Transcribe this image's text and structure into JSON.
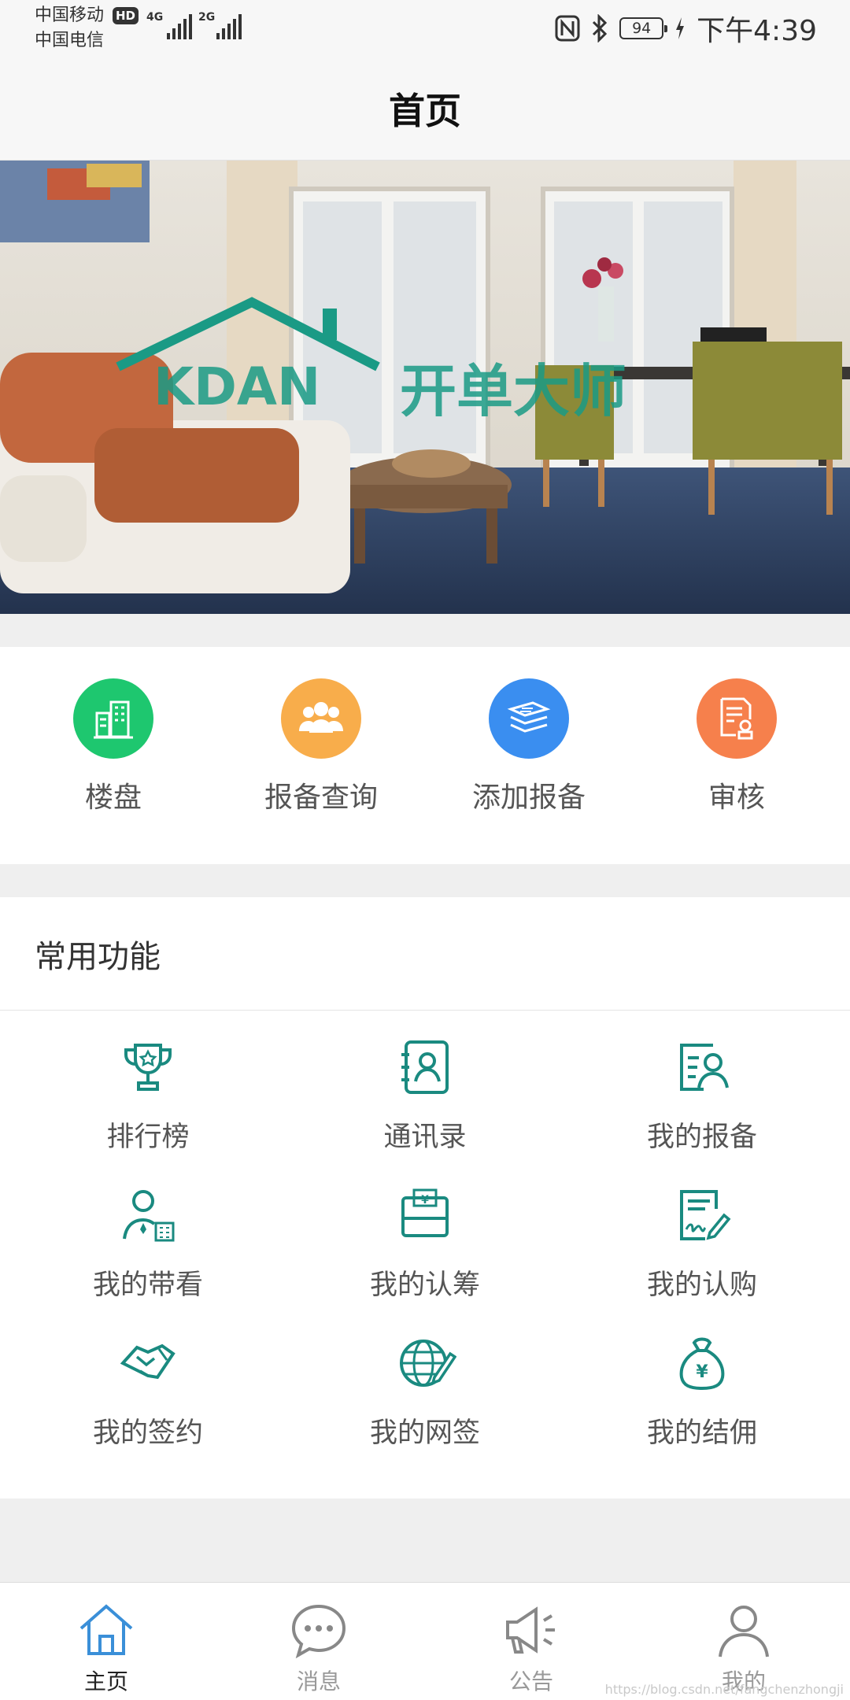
{
  "status_bar": {
    "carrier1": "中国移动",
    "hd": "HD",
    "net1": "4G",
    "carrier2": "中国电信",
    "net2": "2G",
    "battery": "94",
    "time": "下午4:39"
  },
  "header": {
    "title": "首页"
  },
  "banner": {
    "logo_text": "KDAN",
    "brand_text": "开单大师"
  },
  "quick_entries": [
    {
      "label": "楼盘",
      "icon": "buildings-icon",
      "color": "#1ec76f"
    },
    {
      "label": "报备查询",
      "icon": "people-group-icon",
      "color": "#f8ad4b"
    },
    {
      "label": "添加报备",
      "icon": "stack-icon",
      "color": "#3a8ef0"
    },
    {
      "label": "审核",
      "icon": "document-stamp-icon",
      "color": "#f6804c"
    }
  ],
  "common": {
    "title": "常用功能",
    "items": [
      {
        "label": "排行榜",
        "icon": "trophy-icon"
      },
      {
        "label": "通讯录",
        "icon": "contacts-icon"
      },
      {
        "label": "我的报备",
        "icon": "person-card-icon"
      },
      {
        "label": "我的带看",
        "icon": "person-building-icon"
      },
      {
        "label": "我的认筹",
        "icon": "wallet-yen-icon"
      },
      {
        "label": "我的认购",
        "icon": "document-sign-icon"
      },
      {
        "label": "我的签约",
        "icon": "handshake-icon"
      },
      {
        "label": "我的网签",
        "icon": "globe-pen-icon"
      },
      {
        "label": "我的结佣",
        "icon": "money-bag-icon"
      }
    ]
  },
  "tabs": [
    {
      "label": "主页",
      "icon": "home-icon",
      "active": true
    },
    {
      "label": "消息",
      "icon": "chat-icon",
      "active": false
    },
    {
      "label": "公告",
      "icon": "megaphone-icon",
      "active": false
    },
    {
      "label": "我的",
      "icon": "user-icon",
      "active": false
    }
  ],
  "colors": {
    "accent": "#1a8a80",
    "tab_active": "#3a8fd8",
    "tab_inactive": "#888888"
  },
  "watermark": "https://blog.csdn.net/fangchenzhongji"
}
